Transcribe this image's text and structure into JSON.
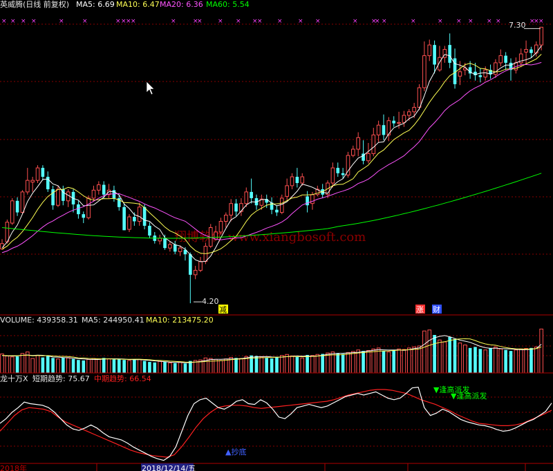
{
  "header": {
    "main_title": "英威腾(日线 前复权)",
    "ma5": "MA5: 6.69",
    "ma10": "MA10: 6.47",
    "ma20": "MA20: 6.36",
    "ma60": "MA60: 5.54"
  },
  "volume_header": {
    "volume": "VOLUME: 439358.31",
    "ma5": "MA5: 244950.41",
    "ma10": "MA10: 213475.20"
  },
  "indicator_header": {
    "name": "龙十万X",
    "short": "短期趋势: 75.67",
    "mid": "中期趋势: 66.54"
  },
  "markers": {
    "max_price": "7.30",
    "min_price": "4.20",
    "jian": "减",
    "zhang": "涨",
    "cai": "财",
    "sell1": "▼逢高派发",
    "sell2": "▼逢高派发",
    "buy": "▲抄底"
  },
  "watermark": "翔博软件 www.xiangbosoft.com",
  "axis": {
    "left_label": "2018年",
    "date_label": "2018/12/14/五"
  },
  "colors": {
    "up": "#ff5050",
    "down": "#54ffff",
    "ma5": "#ffffff",
    "ma10": "#ffff54",
    "ma20": "#ff54ff",
    "ma60": "#00ff00",
    "short_trend": "#ffffff",
    "mid_trend": "#ff2020",
    "grid": "#8a0000"
  },
  "chart_data": [
    {
      "type": "candlestick",
      "title": "英威腾(日线 前复权)",
      "ylim": [
        4.1,
        7.45
      ],
      "candles": [
        [
          4.81,
          4.87,
          4.8,
          4.92
        ],
        [
          4.89,
          5.11,
          4.87,
          5.14
        ],
        [
          5.1,
          5.35,
          5.08,
          5.38
        ],
        [
          5.35,
          5.22,
          5.18,
          5.39
        ],
        [
          5.22,
          5.45,
          5.2,
          5.47
        ],
        [
          5.45,
          5.58,
          5.42,
          5.72
        ],
        [
          5.56,
          5.58,
          5.45,
          5.62
        ],
        [
          5.58,
          5.72,
          5.55,
          5.75
        ],
        [
          5.72,
          5.62,
          5.58,
          5.75
        ],
        [
          5.62,
          5.48,
          5.45,
          5.68
        ],
        [
          5.48,
          5.3,
          5.25,
          5.52
        ],
        [
          5.3,
          5.48,
          5.28,
          5.52
        ],
        [
          5.48,
          5.35,
          5.3,
          5.52
        ],
        [
          5.35,
          5.45,
          5.28,
          5.48
        ],
        [
          5.45,
          5.31,
          5.22,
          5.48
        ],
        [
          5.31,
          5.2,
          5.15,
          5.35
        ],
        [
          5.2,
          5.16,
          5.1,
          5.23
        ],
        [
          5.16,
          5.38,
          5.14,
          5.41
        ],
        [
          5.38,
          5.47,
          5.34,
          5.52
        ],
        [
          5.47,
          5.53,
          5.42,
          5.57
        ],
        [
          5.53,
          5.42,
          5.37,
          5.57
        ],
        [
          5.42,
          5.47,
          5.38,
          5.54
        ],
        [
          5.47,
          5.38,
          5.34,
          5.52
        ],
        [
          5.38,
          5.28,
          5.24,
          5.42
        ],
        [
          5.28,
          5.02,
          5.02,
          5.32
        ],
        [
          5.03,
          5.17,
          5.0,
          5.2
        ],
        [
          5.17,
          5.12,
          5.07,
          5.22
        ],
        [
          5.12,
          5.28,
          5.07,
          5.33
        ],
        [
          5.28,
          5.07,
          5.03,
          5.31
        ],
        [
          5.07,
          4.96,
          4.93,
          5.11
        ],
        [
          4.96,
          4.9,
          4.87,
          5.0
        ],
        [
          4.9,
          4.93,
          4.86,
          4.97
        ],
        [
          4.93,
          4.82,
          4.8,
          4.97
        ],
        [
          4.82,
          4.86,
          4.78,
          4.89
        ],
        [
          4.86,
          4.78,
          4.75,
          4.9
        ],
        [
          4.78,
          4.82,
          4.73,
          4.85
        ],
        [
          4.8,
          4.75,
          4.68,
          4.83
        ],
        [
          4.75,
          4.52,
          4.2,
          4.77
        ],
        [
          4.52,
          4.57,
          4.47,
          4.62
        ],
        [
          4.57,
          4.67,
          4.55,
          4.72
        ],
        [
          4.67,
          4.84,
          4.64,
          4.88
        ],
        [
          4.84,
          5.05,
          4.82,
          5.09
        ],
        [
          4.92,
          5.0,
          4.9,
          5.07
        ],
        [
          5.0,
          5.12,
          4.97,
          5.16
        ],
        [
          5.12,
          5.19,
          5.05,
          5.22
        ],
        [
          5.19,
          5.32,
          5.12,
          5.37
        ],
        [
          5.32,
          5.23,
          5.18,
          5.37
        ],
        [
          5.23,
          5.32,
          5.18,
          5.38
        ],
        [
          5.32,
          5.45,
          5.28,
          5.5
        ],
        [
          5.45,
          5.38,
          5.32,
          5.6
        ],
        [
          5.38,
          5.3,
          5.25,
          5.42
        ],
        [
          5.3,
          5.37,
          5.25,
          5.42
        ],
        [
          5.37,
          5.33,
          5.27,
          5.42
        ],
        [
          5.33,
          5.25,
          5.2,
          5.39
        ],
        [
          5.25,
          5.22,
          5.18,
          5.3
        ],
        [
          5.22,
          5.38,
          5.2,
          5.42
        ],
        [
          5.4,
          5.52,
          5.36,
          5.6
        ],
        [
          5.52,
          5.62,
          5.48,
          5.66
        ],
        [
          5.62,
          5.55,
          5.5,
          5.72
        ],
        [
          5.55,
          5.62,
          5.52,
          5.66
        ],
        [
          5.4,
          5.3,
          5.22,
          5.46
        ],
        [
          5.32,
          5.42,
          5.25,
          5.45
        ],
        [
          5.42,
          5.48,
          5.4,
          5.52
        ],
        [
          5.48,
          5.42,
          5.38,
          5.54
        ],
        [
          5.42,
          5.55,
          5.38,
          5.58
        ],
        [
          5.55,
          5.72,
          5.5,
          5.78
        ],
        [
          5.72,
          5.66,
          5.62,
          5.78
        ],
        [
          5.66,
          5.64,
          5.6,
          5.72
        ],
        [
          5.64,
          5.86,
          5.61,
          5.9
        ],
        [
          5.86,
          5.93,
          5.84,
          5.97
        ],
        [
          5.93,
          6.06,
          5.85,
          6.12
        ],
        [
          5.88,
          5.8,
          5.76,
          6.03
        ],
        [
          5.8,
          5.88,
          5.77,
          6.0
        ],
        [
          5.88,
          6.09,
          5.85,
          6.17
        ],
        [
          6.09,
          6.2,
          6.01,
          6.25
        ],
        [
          6.2,
          6.09,
          6.03,
          6.32
        ],
        [
          6.09,
          6.25,
          6.02,
          6.29
        ],
        [
          6.25,
          6.22,
          6.18,
          6.3
        ],
        [
          6.22,
          6.23,
          6.16,
          6.35
        ],
        [
          6.23,
          6.31,
          6.18,
          6.36
        ],
        [
          6.31,
          6.35,
          6.25,
          6.38
        ],
        [
          6.35,
          6.4,
          6.28,
          6.45
        ],
        [
          6.4,
          6.62,
          6.37,
          6.66
        ],
        [
          6.62,
          6.98,
          6.58,
          7.14
        ],
        [
          6.98,
          7.1,
          6.92,
          7.16
        ],
        [
          7.1,
          6.88,
          6.78,
          7.15
        ],
        [
          6.82,
          6.96,
          6.8,
          7.09
        ],
        [
          6.96,
          7.05,
          6.9,
          7.09
        ],
        [
          7.1,
          6.9,
          6.84,
          7.23
        ],
        [
          6.95,
          6.66,
          6.61,
          7.06
        ],
        [
          6.75,
          6.8,
          6.65,
          6.92
        ],
        [
          6.82,
          6.84,
          6.76,
          6.9
        ],
        [
          6.85,
          6.78,
          6.72,
          6.92
        ],
        [
          6.8,
          6.76,
          6.7,
          6.9
        ],
        [
          6.76,
          6.74,
          6.68,
          6.84
        ],
        [
          6.74,
          6.82,
          6.7,
          6.86
        ],
        [
          6.82,
          6.77,
          6.72,
          6.88
        ],
        [
          6.77,
          6.9,
          6.73,
          6.94
        ],
        [
          6.9,
          6.98,
          6.86,
          7.05
        ],
        [
          6.98,
          6.9,
          6.82,
          7.02
        ],
        [
          6.9,
          6.82,
          6.7,
          6.95
        ],
        [
          6.82,
          6.9,
          6.78,
          6.96
        ],
        [
          6.9,
          7.0,
          6.85,
          7.06
        ],
        [
          7.02,
          7.05,
          6.88,
          7.15
        ],
        [
          7.05,
          7.01,
          6.96,
          7.08
        ],
        [
          7.01,
          7.1,
          6.97,
          7.14
        ],
        [
          7.1,
          7.3,
          7.04,
          7.3
        ]
      ],
      "ma5_last": 6.69,
      "ma10_last": 6.47,
      "ma20_last": 6.36,
      "ma60_last": 5.54,
      "annotations": [
        "7.30",
        "4.20",
        "减",
        "涨",
        "财"
      ]
    },
    {
      "type": "bar",
      "title": "VOLUME",
      "ylim": [
        0,
        470000
      ],
      "volumes": [
        190000,
        170000,
        160000,
        165000,
        195000,
        210000,
        145000,
        175000,
        155000,
        170000,
        150000,
        140000,
        155000,
        150000,
        140000,
        130000,
        125000,
        135000,
        145000,
        140000,
        150000,
        140000,
        135000,
        140000,
        130000,
        125000,
        135000,
        135000,
        120000,
        110000,
        105000,
        115000,
        110000,
        100000,
        98000,
        105000,
        95000,
        120000,
        125000,
        130000,
        150000,
        145000,
        135000,
        125000,
        140000,
        155000,
        150000,
        145000,
        165000,
        175000,
        170000,
        160000,
        150000,
        145000,
        160000,
        175000,
        185000,
        170000,
        160000,
        150000,
        180000,
        175000,
        185000,
        190000,
        200000,
        210000,
        195000,
        190000,
        205000,
        215000,
        230000,
        220000,
        225000,
        240000,
        250000,
        220000,
        210000,
        230000,
        240000,
        235000,
        250000,
        260000,
        270000,
        420000,
        430000,
        380000,
        330000,
        310000,
        360000,
        340000,
        300000,
        280000,
        250000,
        260000,
        240000,
        230000,
        250000,
        260000,
        240000,
        230000,
        220000,
        230000,
        240000,
        245000,
        250000,
        260000,
        439358
      ],
      "ma5_last": 244950.41,
      "ma10_last": 213475.2
    },
    {
      "type": "line",
      "title": "龙十万X",
      "ylim": [
        0,
        100
      ],
      "series": [
        {
          "name": "短期趋势",
          "values": [
            50,
            56,
            64,
            70,
            77,
            75,
            74,
            73,
            70,
            64,
            56,
            48,
            43,
            41,
            44,
            48,
            44,
            38,
            33,
            31,
            29,
            25,
            20,
            16,
            12,
            8,
            5,
            3,
            8,
            20,
            40,
            60,
            75,
            80,
            82,
            76,
            70,
            68,
            72,
            78,
            80,
            75,
            74,
            80,
            76,
            68,
            58,
            56,
            62,
            70,
            72,
            74,
            72,
            70,
            72,
            76,
            80,
            84,
            86,
            88,
            86,
            88,
            90,
            86,
            82,
            80,
            82,
            88,
            95,
            96,
            70,
            60,
            63,
            68,
            65,
            60,
            55,
            52,
            50,
            48,
            47,
            45,
            42,
            40,
            41,
            44,
            48,
            52,
            55,
            60,
            65,
            75.67
          ]
        },
        {
          "name": "中期趋势",
          "values": [
            40,
            50,
            60,
            67,
            70,
            69,
            68,
            65,
            58,
            52,
            48,
            44,
            40,
            36,
            32,
            28,
            24,
            20,
            16,
            13,
            11,
            9,
            8,
            7,
            10,
            20,
            32,
            45,
            56,
            64,
            70,
            72,
            73,
            73,
            72,
            70,
            69,
            70,
            71,
            72,
            73,
            74,
            75,
            76,
            77,
            78,
            80,
            83,
            86,
            88,
            90,
            92,
            93,
            93,
            92,
            90,
            88,
            84,
            80,
            77,
            74,
            70,
            66,
            61,
            57,
            53,
            50,
            49,
            48,
            47,
            47,
            48,
            50,
            54,
            58,
            62,
            66.54
          ]
        }
      ],
      "annotations": [
        "▼逢高派发",
        "▼逢高派发",
        "▲抄底"
      ]
    }
  ]
}
